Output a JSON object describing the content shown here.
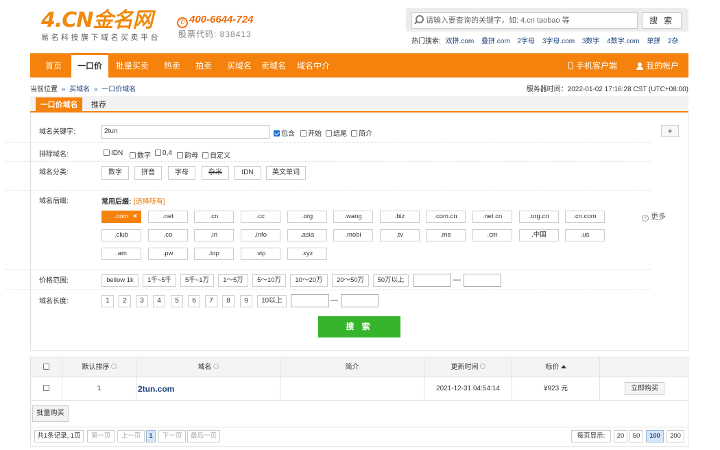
{
  "header": {
    "logo_main": "4.CN金名网",
    "logo_sub": "易名科技旗下域名买卖平台",
    "phone": "400-6644-724",
    "stock_code": "股票代码: 838413",
    "search_placeholder": "请输入要查询的关键字，如: 4.cn taobao 等",
    "search_button": "搜 索",
    "hot_label": "热门搜索:",
    "hot_items": [
      "双拼.com",
      "叠拼.com",
      "2字母",
      "3字母.com",
      "3数字",
      "4数字.com",
      "单拼",
      "2杂"
    ]
  },
  "nav": {
    "items": [
      "首页",
      "一口价",
      "批量买卖",
      "热卖",
      "拍卖",
      "买域名",
      "卖域名",
      "域名中介"
    ],
    "active": "一口价",
    "mobile": "手机客户端",
    "account": "我的帐户"
  },
  "breadcrumb": {
    "current": "当前位置",
    "level1": "买域名",
    "level2": "一口价域名",
    "server_time": "服务器时间：2022-01-02 17:16:28 CST (UTC+08:00)"
  },
  "tabs": [
    "一口价域名",
    "推荐"
  ],
  "filter": {
    "keyword_label": "域名关键字:",
    "keyword_value": "2tun",
    "keyword_opts": [
      {
        "label": "包含",
        "checked": true
      },
      {
        "label": "开始",
        "checked": false
      },
      {
        "label": "结尾",
        "checked": false
      },
      {
        "label": "简介",
        "checked": false
      }
    ],
    "plus": "+",
    "exclude_label": "排除域名:",
    "exclude_opts": [
      "IDN",
      "数字",
      "0,4",
      "韵母",
      "自定义"
    ],
    "category_label": "域名分类:",
    "categories": [
      "数字",
      "拼音",
      "字母",
      "杂米",
      "IDN",
      "英文单词"
    ],
    "suffix_label": "域名后缀:",
    "common_suffix": "常用后缀:",
    "select_all": "[选择所有]",
    "suffixes": [
      ".com",
      ".net",
      ".cn",
      ".cc",
      ".org",
      ".wang",
      ".biz",
      ".com.cn",
      ".net.cn",
      ".org.cn",
      ".cn.com",
      ".club",
      ".co",
      ".in",
      ".info",
      ".asia",
      ".mobi",
      ".tv",
      ".me",
      ".cm",
      ".中国",
      ".us",
      ".am",
      ".pw",
      ".top",
      ".vip",
      ".xyz"
    ],
    "selected_suffix": ".com",
    "more": "更多",
    "price_label": "价格范围:",
    "prices": [
      "bellow 1k",
      "1千~5千",
      "5千~1万",
      "1～5万",
      "5～10万",
      "10～20万",
      "20～50万",
      "50万以上"
    ],
    "length_label": "域名长度:",
    "lengths": [
      "1",
      "2",
      "3",
      "4",
      "5",
      "6",
      "7",
      "8",
      "9",
      "10以上"
    ],
    "dash": "—",
    "submit": "搜 索"
  },
  "table": {
    "headers": [
      "默认排序",
      "域名",
      "简介",
      "更新时间",
      "标价"
    ],
    "rows": [
      {
        "index": "1",
        "domain": "2tun.com",
        "intro": "",
        "updated": "2021-12-31 04:54:14",
        "price": "¥923 元",
        "action": "立即购买"
      }
    ],
    "bulk_buy": "批量购买",
    "pagination": {
      "info": "共1条记录, 1页",
      "first": "第一页",
      "prev": "上一页",
      "current": "1",
      "next": "下一页",
      "last": "最后一页",
      "per_page_label": "每页显示:",
      "sizes": [
        "20",
        "50",
        "100",
        "200"
      ],
      "active_size": "100"
    }
  },
  "colors": {
    "brand_orange": "#f5820c",
    "submit_green": "#36b52c",
    "link_blue": "#1a3f7a"
  }
}
